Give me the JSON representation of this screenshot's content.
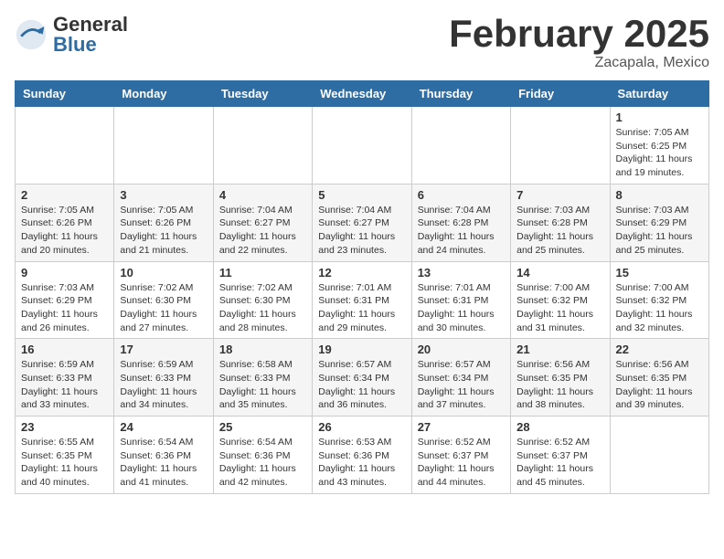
{
  "header": {
    "logo": {
      "general": "General",
      "blue": "Blue"
    },
    "month": "February 2025",
    "location": "Zacapala, Mexico"
  },
  "days_of_week": [
    "Sunday",
    "Monday",
    "Tuesday",
    "Wednesday",
    "Thursday",
    "Friday",
    "Saturday"
  ],
  "weeks": [
    [
      {
        "day": "",
        "info": ""
      },
      {
        "day": "",
        "info": ""
      },
      {
        "day": "",
        "info": ""
      },
      {
        "day": "",
        "info": ""
      },
      {
        "day": "",
        "info": ""
      },
      {
        "day": "",
        "info": ""
      },
      {
        "day": "1",
        "info": "Sunrise: 7:05 AM\nSunset: 6:25 PM\nDaylight: 11 hours and 19 minutes."
      }
    ],
    [
      {
        "day": "2",
        "info": "Sunrise: 7:05 AM\nSunset: 6:26 PM\nDaylight: 11 hours and 20 minutes."
      },
      {
        "day": "3",
        "info": "Sunrise: 7:05 AM\nSunset: 6:26 PM\nDaylight: 11 hours and 21 minutes."
      },
      {
        "day": "4",
        "info": "Sunrise: 7:04 AM\nSunset: 6:27 PM\nDaylight: 11 hours and 22 minutes."
      },
      {
        "day": "5",
        "info": "Sunrise: 7:04 AM\nSunset: 6:27 PM\nDaylight: 11 hours and 23 minutes."
      },
      {
        "day": "6",
        "info": "Sunrise: 7:04 AM\nSunset: 6:28 PM\nDaylight: 11 hours and 24 minutes."
      },
      {
        "day": "7",
        "info": "Sunrise: 7:03 AM\nSunset: 6:28 PM\nDaylight: 11 hours and 25 minutes."
      },
      {
        "day": "8",
        "info": "Sunrise: 7:03 AM\nSunset: 6:29 PM\nDaylight: 11 hours and 25 minutes."
      }
    ],
    [
      {
        "day": "9",
        "info": "Sunrise: 7:03 AM\nSunset: 6:29 PM\nDaylight: 11 hours and 26 minutes."
      },
      {
        "day": "10",
        "info": "Sunrise: 7:02 AM\nSunset: 6:30 PM\nDaylight: 11 hours and 27 minutes."
      },
      {
        "day": "11",
        "info": "Sunrise: 7:02 AM\nSunset: 6:30 PM\nDaylight: 11 hours and 28 minutes."
      },
      {
        "day": "12",
        "info": "Sunrise: 7:01 AM\nSunset: 6:31 PM\nDaylight: 11 hours and 29 minutes."
      },
      {
        "day": "13",
        "info": "Sunrise: 7:01 AM\nSunset: 6:31 PM\nDaylight: 11 hours and 30 minutes."
      },
      {
        "day": "14",
        "info": "Sunrise: 7:00 AM\nSunset: 6:32 PM\nDaylight: 11 hours and 31 minutes."
      },
      {
        "day": "15",
        "info": "Sunrise: 7:00 AM\nSunset: 6:32 PM\nDaylight: 11 hours and 32 minutes."
      }
    ],
    [
      {
        "day": "16",
        "info": "Sunrise: 6:59 AM\nSunset: 6:33 PM\nDaylight: 11 hours and 33 minutes."
      },
      {
        "day": "17",
        "info": "Sunrise: 6:59 AM\nSunset: 6:33 PM\nDaylight: 11 hours and 34 minutes."
      },
      {
        "day": "18",
        "info": "Sunrise: 6:58 AM\nSunset: 6:33 PM\nDaylight: 11 hours and 35 minutes."
      },
      {
        "day": "19",
        "info": "Sunrise: 6:57 AM\nSunset: 6:34 PM\nDaylight: 11 hours and 36 minutes."
      },
      {
        "day": "20",
        "info": "Sunrise: 6:57 AM\nSunset: 6:34 PM\nDaylight: 11 hours and 37 minutes."
      },
      {
        "day": "21",
        "info": "Sunrise: 6:56 AM\nSunset: 6:35 PM\nDaylight: 11 hours and 38 minutes."
      },
      {
        "day": "22",
        "info": "Sunrise: 6:56 AM\nSunset: 6:35 PM\nDaylight: 11 hours and 39 minutes."
      }
    ],
    [
      {
        "day": "23",
        "info": "Sunrise: 6:55 AM\nSunset: 6:35 PM\nDaylight: 11 hours and 40 minutes."
      },
      {
        "day": "24",
        "info": "Sunrise: 6:54 AM\nSunset: 6:36 PM\nDaylight: 11 hours and 41 minutes."
      },
      {
        "day": "25",
        "info": "Sunrise: 6:54 AM\nSunset: 6:36 PM\nDaylight: 11 hours and 42 minutes."
      },
      {
        "day": "26",
        "info": "Sunrise: 6:53 AM\nSunset: 6:36 PM\nDaylight: 11 hours and 43 minutes."
      },
      {
        "day": "27",
        "info": "Sunrise: 6:52 AM\nSunset: 6:37 PM\nDaylight: 11 hours and 44 minutes."
      },
      {
        "day": "28",
        "info": "Sunrise: 6:52 AM\nSunset: 6:37 PM\nDaylight: 11 hours and 45 minutes."
      },
      {
        "day": "",
        "info": ""
      }
    ]
  ]
}
